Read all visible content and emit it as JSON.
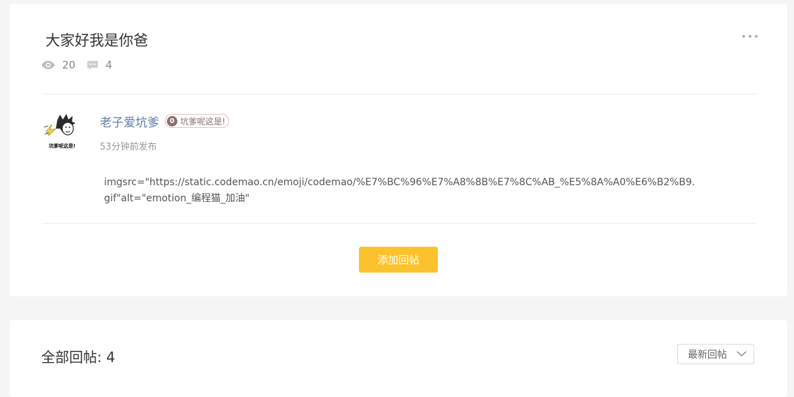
{
  "post": {
    "title": "大家好我是你爸",
    "views": "20",
    "comments": "4",
    "author": {
      "name": "老子爱坑爹",
      "badge_level": "0",
      "badge_text": "坑爹呢这是!",
      "avatar_caption": "坑爹呢这是!"
    },
    "time": "53分钟前发布",
    "body": "imgsrc=\"https://static.codemao.cn/emoji/codemao/%E7%BC%96%E7%A8%8B%E7%8C%AB_%E5%8A%A0%E6%B2%B9.gif\"alt=\"emotion_编程猫_加油\"",
    "reply_button": "添加回帖"
  },
  "replies": {
    "title": "全部回帖: 4",
    "sort": {
      "selected": "最新回帖"
    }
  },
  "icons": {
    "views": "eye-icon",
    "comments": "comment-icon",
    "more": "more-dots-icon",
    "sort": "chevron-down-icon"
  },
  "colors": {
    "accent": "#fcc22e",
    "author_link": "#5c7da8",
    "background": "#f5f5f5"
  }
}
